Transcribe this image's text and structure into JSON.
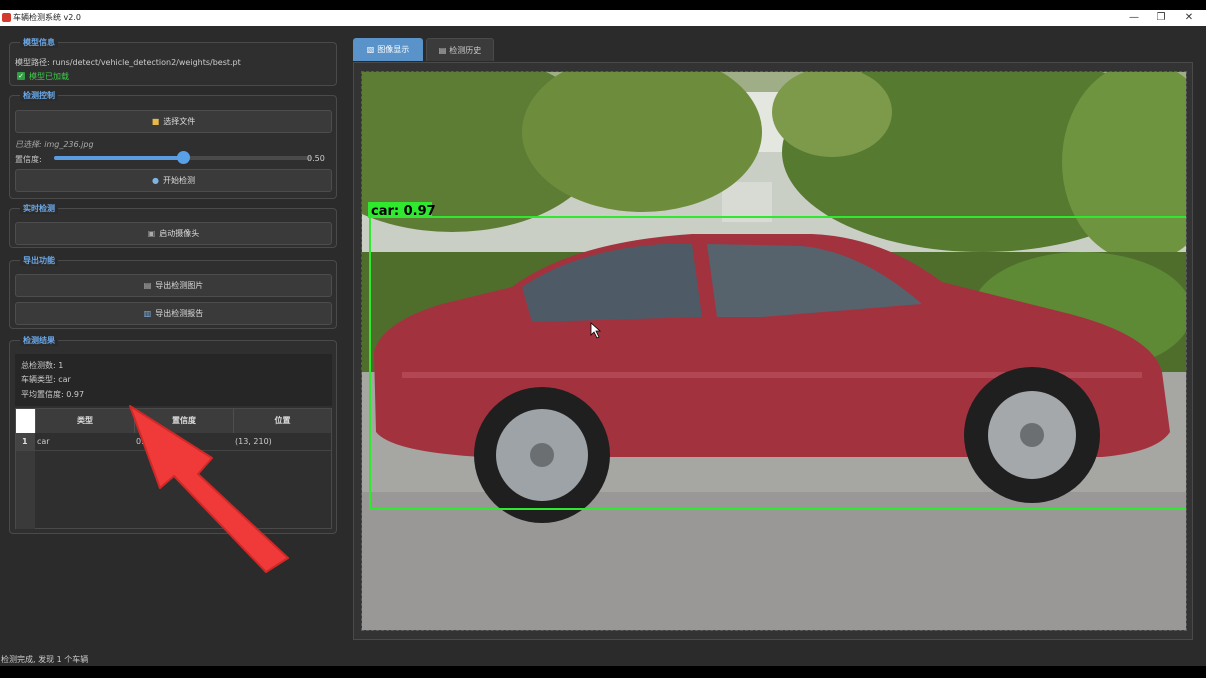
{
  "window": {
    "title": "车辆检测系统 v2.0",
    "controls": {
      "minimize": "—",
      "maximize": "❐",
      "close": "✕"
    }
  },
  "model_info": {
    "group_title": "模型信息",
    "path_text": "模型路径: runs/detect/vehicle_detection2/weights/best.pt",
    "loaded_text": "模型已加载"
  },
  "detection_control": {
    "group_title": "检测控制",
    "select_file_label": "选择文件",
    "selected_text": "已选择: img_236.jpg",
    "confidence_label": "置信度:",
    "confidence_value": "0.50",
    "confidence_fraction": 0.5,
    "start_label": "开始检测"
  },
  "realtime": {
    "group_title": "实时检测",
    "camera_label": "启动摄像头"
  },
  "export": {
    "group_title": "导出功能",
    "export_image_label": "导出检测图片",
    "export_report_label": "导出检测报告"
  },
  "results": {
    "group_title": "检测结果",
    "total_text": "总检测数: 1",
    "type_text": "车辆类型: car",
    "avg_conf_text": "平均置信度: 0.97",
    "columns": [
      "类型",
      "置信度",
      "位置"
    ],
    "rows": [
      {
        "num": "1",
        "type": "car",
        "confidence": "0.97",
        "position": "(13, 210)"
      }
    ]
  },
  "tabs": [
    {
      "label": "图像显示",
      "active": true
    },
    {
      "label": "检测历史",
      "active": false
    }
  ],
  "detection_overlay": {
    "label": "car: 0.97",
    "box_color": "#2fe82f"
  },
  "status": {
    "text": "检测完成, 发现 1 个车辆"
  },
  "colors": {
    "accent": "#5a93c9",
    "group_title": "#6aa8e8",
    "annotation_arrow": "#f03a3a"
  }
}
